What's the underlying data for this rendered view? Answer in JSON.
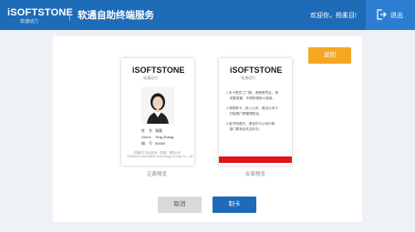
{
  "header": {
    "logo_text": "iSOFTSTONE",
    "logo_sub": "软通动力",
    "title": "软通自助终端服务",
    "welcome": "欢迎你，杨素目!",
    "logout_label": "退出",
    "logout_icon": "logout-icon"
  },
  "actions": {
    "back_label": "返回",
    "cancel_label": "取消",
    "make_label": "制卡"
  },
  "front_card": {
    "brand": "iSOFTSTONE",
    "brand_sub": "软通动力",
    "fields": [
      {
        "label": "姓　名",
        "value": "张颖"
      },
      {
        "label": "Name",
        "value": "Ying Zhang"
      },
      {
        "label": "编　号",
        "value": "00000"
      }
    ],
    "footer_lines": [
      "软通动力信息技术（集团）有限公司",
      "iSoftStone Information Technology (Group) Co., Ltd."
    ],
    "caption": "正面预览"
  },
  "back_card": {
    "brand": "iSOFTSTONE",
    "brand_sub": "软通动力",
    "lines": [
      "1.本卡是员工门禁、考勤等凭证，请",
      "　妥善保管，不得转借他人使用。",
      "",
      "2.请佩带卡，进入公司，请出示本卡",
      "　并接受门禁管理验证。",
      "",
      "3.若不慎遗失，请及时与公司行政",
      "　部门联系挂失及补办。"
    ],
    "caption": "反面预览"
  },
  "colors": {
    "header_bg": "#1e6bb8",
    "accent_orange": "#f5a623",
    "card_red": "#e0141b"
  }
}
